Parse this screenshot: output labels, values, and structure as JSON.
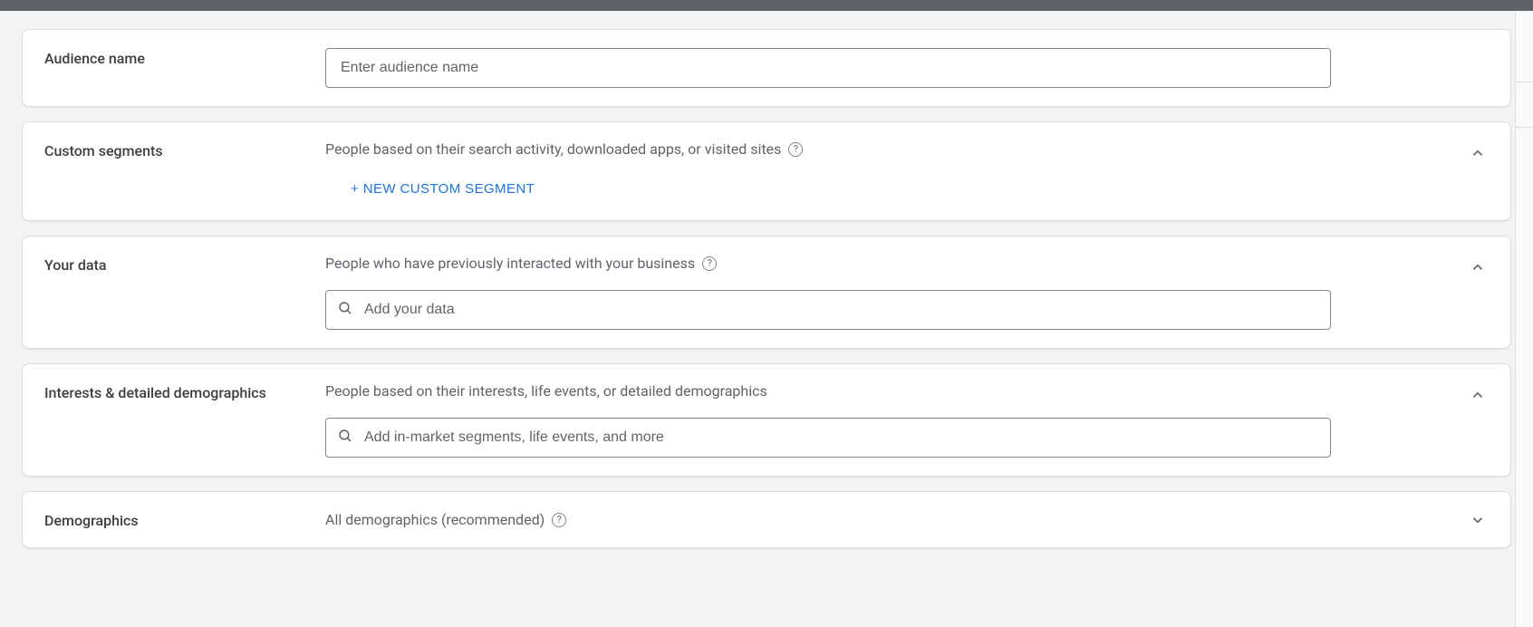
{
  "audienceName": {
    "label": "Audience name",
    "placeholder": "Enter audience name",
    "value": ""
  },
  "customSegments": {
    "label": "Custom segments",
    "description": "People based on their search activity, downloaded apps, or visited sites",
    "newButton": "+ NEW CUSTOM SEGMENT"
  },
  "yourData": {
    "label": "Your data",
    "description": "People who have previously interacted with your business",
    "searchPlaceholder": "Add your data"
  },
  "interests": {
    "label": "Interests & detailed demographics",
    "description": "People based on their interests, life events, or detailed demographics",
    "searchPlaceholder": "Add in-market segments, life events, and more"
  },
  "demographics": {
    "label": "Demographics",
    "description": "All demographics (recommended)"
  }
}
